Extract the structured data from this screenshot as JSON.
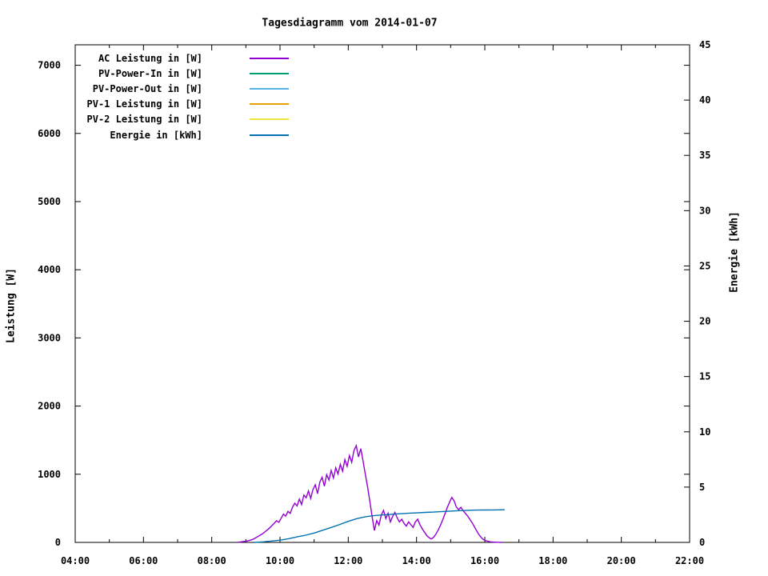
{
  "title": "Tagesdiagramm vom 2014-01-07",
  "axes": {
    "y_left_label": "Leistung [W]",
    "y_right_label": "Energie [kWh]"
  },
  "chart_data": {
    "type": "line",
    "title": "Tagesdiagramm vom 2014-01-07",
    "background": "#ffffff",
    "border_color": "#000000",
    "legend_position": "top-left-inside",
    "grid": false,
    "x_axis": {
      "unit": "time-of-day",
      "range": [
        "04:00",
        "22:00"
      ],
      "major_tick_hours": 2,
      "minor_tick_hours": 1,
      "tick_labels": [
        "04:00",
        "06:00",
        "08:00",
        "10:00",
        "12:00",
        "14:00",
        "16:00",
        "18:00",
        "20:00",
        "22:00"
      ]
    },
    "y_left_axis": {
      "label": "Leistung [W]",
      "range": [
        0,
        7300
      ],
      "ticks": [
        0,
        1000,
        2000,
        3000,
        4000,
        5000,
        6000,
        7000
      ]
    },
    "y_right_axis": {
      "label": "Energie [kWh]",
      "range": [
        0,
        45
      ],
      "ticks": [
        0,
        5,
        10,
        15,
        20,
        25,
        30,
        35,
        40,
        45
      ]
    },
    "series": [
      {
        "name": "AC Leistung in [W]",
        "color": "#9400d3",
        "axis": "left",
        "points": [
          [
            "08:45",
            0
          ],
          [
            "08:50",
            5
          ],
          [
            "08:54",
            10
          ],
          [
            "08:58",
            15
          ],
          [
            "09:02",
            20
          ],
          [
            "09:06",
            28
          ],
          [
            "09:10",
            38
          ],
          [
            "09:14",
            52
          ],
          [
            "09:18",
            70
          ],
          [
            "09:22",
            90
          ],
          [
            "09:26",
            110
          ],
          [
            "09:30",
            132
          ],
          [
            "09:34",
            158
          ],
          [
            "09:38",
            185
          ],
          [
            "09:42",
            215
          ],
          [
            "09:46",
            248
          ],
          [
            "09:50",
            282
          ],
          [
            "09:54",
            318
          ],
          [
            "09:58",
            295
          ],
          [
            "10:02",
            355
          ],
          [
            "10:06",
            415
          ],
          [
            "10:10",
            385
          ],
          [
            "10:14",
            455
          ],
          [
            "10:18",
            425
          ],
          [
            "10:22",
            515
          ],
          [
            "10:26",
            575
          ],
          [
            "10:30",
            535
          ],
          [
            "10:34",
            635
          ],
          [
            "10:38",
            555
          ],
          [
            "10:42",
            695
          ],
          [
            "10:46",
            655
          ],
          [
            "10:50",
            755
          ],
          [
            "10:54",
            645
          ],
          [
            "10:58",
            775
          ],
          [
            "11:02",
            845
          ],
          [
            "11:06",
            715
          ],
          [
            "11:10",
            885
          ],
          [
            "11:14",
            955
          ],
          [
            "11:18",
            825
          ],
          [
            "11:22",
            995
          ],
          [
            "11:26",
            915
          ],
          [
            "11:30",
            1055
          ],
          [
            "11:34",
            945
          ],
          [
            "11:38",
            1095
          ],
          [
            "11:42",
            1005
          ],
          [
            "11:46",
            1145
          ],
          [
            "11:50",
            1045
          ],
          [
            "11:54",
            1215
          ],
          [
            "11:58",
            1115
          ],
          [
            "12:02",
            1275
          ],
          [
            "12:06",
            1175
          ],
          [
            "12:10",
            1345
          ],
          [
            "12:14",
            1420
          ],
          [
            "12:18",
            1255
          ],
          [
            "12:22",
            1375
          ],
          [
            "12:26",
            1195
          ],
          [
            "12:30",
            995
          ],
          [
            "12:34",
            815
          ],
          [
            "12:38",
            595
          ],
          [
            "12:42",
            375
          ],
          [
            "12:46",
            175
          ],
          [
            "12:50",
            320
          ],
          [
            "12:54",
            255
          ],
          [
            "12:58",
            400
          ],
          [
            "13:02",
            470
          ],
          [
            "13:06",
            350
          ],
          [
            "13:10",
            430
          ],
          [
            "13:14",
            300
          ],
          [
            "13:18",
            380
          ],
          [
            "13:22",
            440
          ],
          [
            "13:26",
            360
          ],
          [
            "13:30",
            300
          ],
          [
            "13:34",
            340
          ],
          [
            "13:38",
            280
          ],
          [
            "13:42",
            240
          ],
          [
            "13:46",
            300
          ],
          [
            "13:50",
            260
          ],
          [
            "13:54",
            220
          ],
          [
            "13:58",
            300
          ],
          [
            "14:02",
            340
          ],
          [
            "14:06",
            260
          ],
          [
            "14:10",
            200
          ],
          [
            "14:14",
            150
          ],
          [
            "14:18",
            100
          ],
          [
            "14:22",
            70
          ],
          [
            "14:26",
            50
          ],
          [
            "14:30",
            75
          ],
          [
            "14:34",
            120
          ],
          [
            "14:38",
            180
          ],
          [
            "14:42",
            250
          ],
          [
            "14:46",
            330
          ],
          [
            "14:50",
            420
          ],
          [
            "14:54",
            510
          ],
          [
            "14:58",
            590
          ],
          [
            "15:02",
            660
          ],
          [
            "15:06",
            610
          ],
          [
            "15:10",
            520
          ],
          [
            "15:14",
            480
          ],
          [
            "15:18",
            515
          ],
          [
            "15:22",
            465
          ],
          [
            "15:26",
            425
          ],
          [
            "15:30",
            385
          ],
          [
            "15:34",
            335
          ],
          [
            "15:38",
            285
          ],
          [
            "15:42",
            225
          ],
          [
            "15:46",
            165
          ],
          [
            "15:50",
            110
          ],
          [
            "15:54",
            70
          ],
          [
            "15:58",
            40
          ],
          [
            "16:02",
            25
          ],
          [
            "16:06",
            15
          ],
          [
            "16:10",
            8
          ],
          [
            "16:14",
            5
          ],
          [
            "16:18",
            3
          ],
          [
            "16:22",
            2
          ],
          [
            "16:26",
            1
          ],
          [
            "16:30",
            0
          ]
        ]
      },
      {
        "name": "PV-Power-In in [W]",
        "color": "#009e73",
        "axis": "left",
        "points": []
      },
      {
        "name": "PV-Power-Out in [W]",
        "color": "#56b4e9",
        "axis": "left",
        "points": []
      },
      {
        "name": "PV-1 Leistung in [W]",
        "color": "#e69f00",
        "axis": "left",
        "points": []
      },
      {
        "name": "PV-2 Leistung in [W]",
        "color": "#f0e442",
        "axis": "left",
        "points": []
      },
      {
        "name": "Energie in [kWh]",
        "color": "#0072b2",
        "axis": "right",
        "points": [
          [
            "09:15",
            0.0
          ],
          [
            "09:30",
            0.05
          ],
          [
            "09:45",
            0.12
          ],
          [
            "10:00",
            0.2
          ],
          [
            "10:15",
            0.33
          ],
          [
            "10:30",
            0.5
          ],
          [
            "10:45",
            0.65
          ],
          [
            "11:00",
            0.85
          ],
          [
            "11:15",
            1.1
          ],
          [
            "11:30",
            1.35
          ],
          [
            "11:45",
            1.62
          ],
          [
            "12:00",
            1.9
          ],
          [
            "12:15",
            2.15
          ],
          [
            "12:30",
            2.32
          ],
          [
            "12:45",
            2.42
          ],
          [
            "13:00",
            2.48
          ],
          [
            "13:15",
            2.54
          ],
          [
            "13:30",
            2.59
          ],
          [
            "13:45",
            2.63
          ],
          [
            "14:00",
            2.67
          ],
          [
            "14:15",
            2.71
          ],
          [
            "14:30",
            2.74
          ],
          [
            "14:45",
            2.79
          ],
          [
            "15:00",
            2.83
          ],
          [
            "15:15",
            2.87
          ],
          [
            "15:30",
            2.9
          ],
          [
            "15:45",
            2.92
          ],
          [
            "16:00",
            2.93
          ],
          [
            "16:15",
            2.94
          ],
          [
            "16:35",
            2.95
          ]
        ]
      }
    ]
  }
}
